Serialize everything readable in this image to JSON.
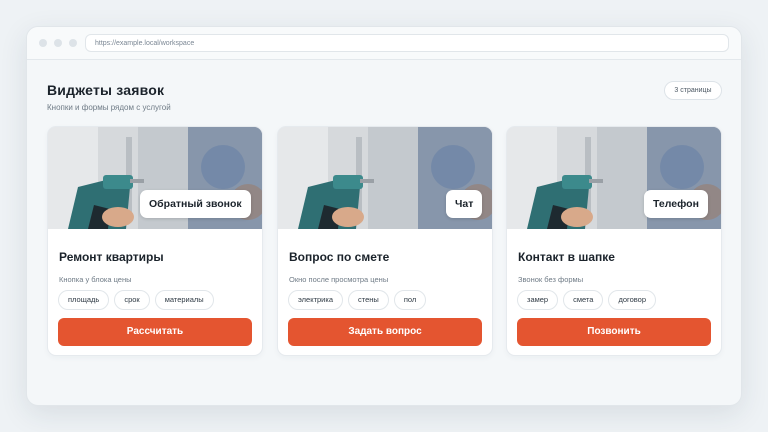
{
  "browser": {
    "url": "https://example.local/workspace"
  },
  "header": {
    "title": "Виджеты заявок",
    "subtitle": "Кнопки и формы рядом с услугой",
    "pages_badge": "3 страницы"
  },
  "cards": [
    {
      "image_tag": "Обратный звонок",
      "title": "Ремонт квартиры",
      "description": "Кнопка у блока цены",
      "chips": [
        "площадь",
        "срок",
        "материалы"
      ],
      "cta": "Рассчитать"
    },
    {
      "image_tag": "Чат",
      "title": "Вопрос по смете",
      "description": "Окно после просмотра цены",
      "chips": [
        "электрика",
        "стены",
        "пол"
      ],
      "cta": "Задать вопрос"
    },
    {
      "image_tag": "Телефон",
      "title": "Контакт в шапке",
      "description": "Звонок без формы",
      "chips": [
        "замер",
        "смета",
        "договор"
      ],
      "cta": "Позвонить"
    }
  ],
  "colors": {
    "accent": "#e45530",
    "page_bg": "#eef2f5",
    "text": "#1b232b"
  }
}
